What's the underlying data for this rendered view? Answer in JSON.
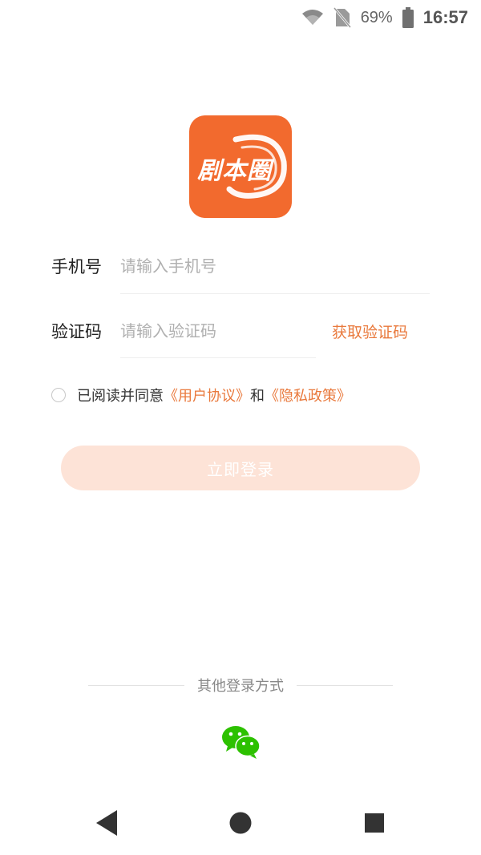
{
  "status_bar": {
    "battery": "69%",
    "time": "16:57",
    "icons": [
      "wifi-icon",
      "no-sim-icon",
      "battery-icon"
    ]
  },
  "app": {
    "logo_text": "剧本圈",
    "brand_color": "#f26a2e",
    "accent_color": "#e9793c"
  },
  "form": {
    "phone_label": "手机号",
    "phone_placeholder": "请输入手机号",
    "phone_value": "",
    "code_label": "验证码",
    "code_placeholder": "请输入验证码",
    "code_value": "",
    "get_code_label": "获取验证码"
  },
  "agreement": {
    "checked": false,
    "prefix": "已阅读并同意",
    "user_agreement": "《用户协议》",
    "conjunction": "和",
    "privacy_policy": "《隐私政策》"
  },
  "login_button_label": "立即登录",
  "other_login": {
    "title": "其他登录方式",
    "methods": [
      "wechat-icon"
    ]
  },
  "nav_bar": {
    "icons": [
      "back-icon",
      "home-icon",
      "recents-icon"
    ]
  }
}
